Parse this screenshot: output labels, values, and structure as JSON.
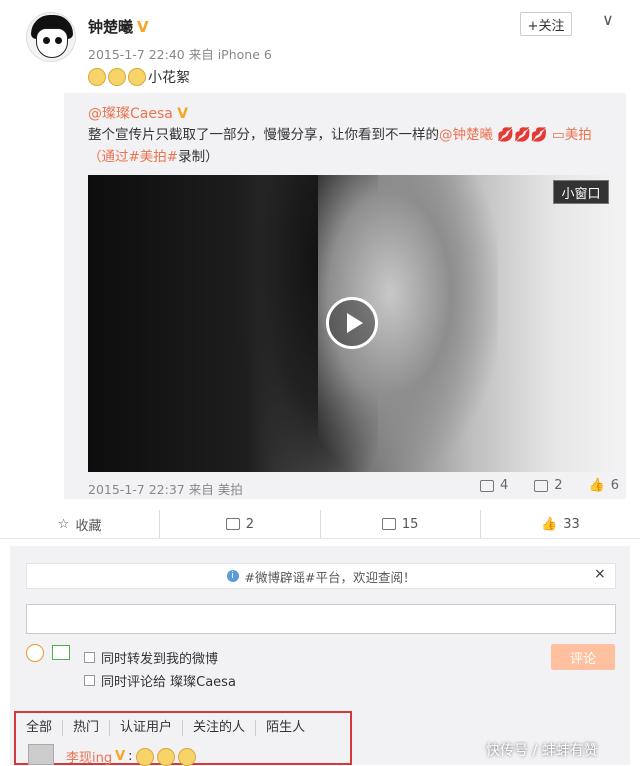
{
  "post": {
    "author": "钟楚曦",
    "verified_badge": "V",
    "timestamp": "2015-1-7 22:40",
    "source": "来自 iPhone 6",
    "text": "小花絮",
    "follow_label": "+关注"
  },
  "repost": {
    "author": "@璨璨Caesa",
    "text_part1": "整个宣传片只截取了一部分，慢慢分享，让你看到不一样的",
    "mention": "@钟楚曦",
    "text_part2": "美拍（通过",
    "hashtag": "#美拍#",
    "text_part3": "录制）",
    "mini_window_label": "小窗口",
    "timestamp": "2015-1-7 22:37",
    "source": "来自 美拍",
    "stats": {
      "reposts": "4",
      "comments": "2",
      "likes": "6"
    }
  },
  "actions": {
    "favorite_label": "收藏",
    "repost_count": "2",
    "comment_count": "15",
    "like_count": "33"
  },
  "comment_box": {
    "notice": "#微博辟谣#平台，欢迎查阅！",
    "close_label": "×",
    "option1": "同时转发到我的微博",
    "option2": "同时评论给 璨璨Caesa",
    "submit_label": "评论"
  },
  "filters": [
    "全部",
    "热门",
    "认证用户",
    "关注的人",
    "陌生人"
  ],
  "first_comment": {
    "user": "李现ing",
    "badge": "V"
  },
  "watermark": "快传号 / 蚌蚌有赞",
  "colors": {
    "accent": "#eb7350",
    "badge": "#f5a623",
    "highlight_border": "#d23a3a"
  }
}
